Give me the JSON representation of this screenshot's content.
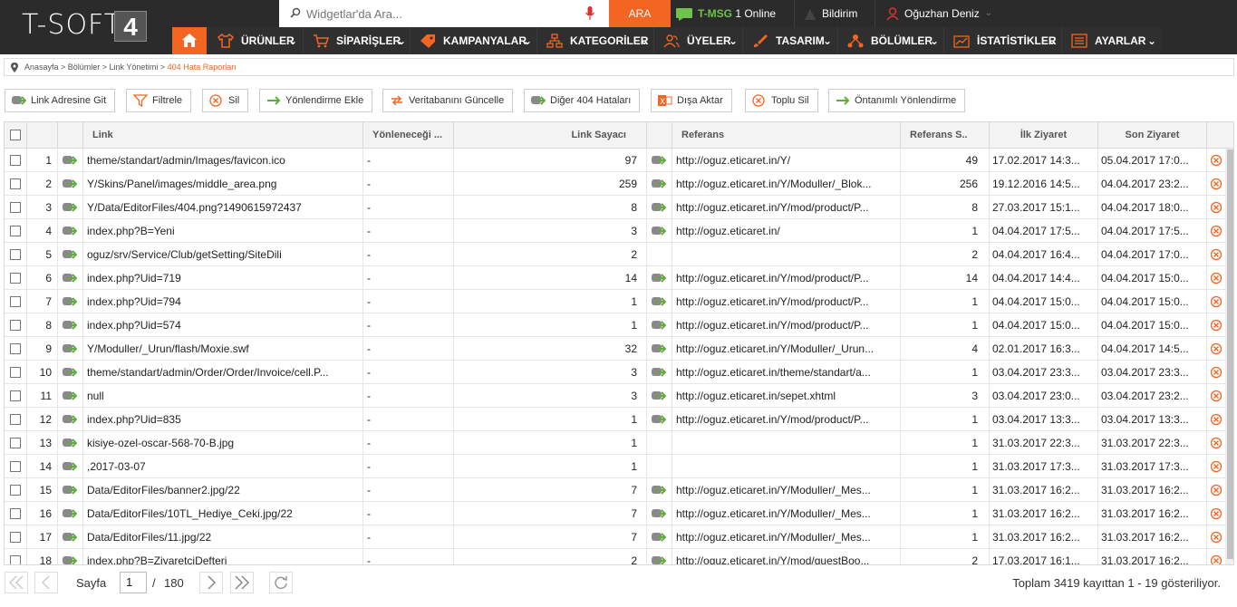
{
  "brand": {
    "logo_text": "T-SOFT",
    "logo_version": "4"
  },
  "search": {
    "placeholder": "Widgetlar'da Ara...",
    "button": "ARA"
  },
  "topbar": {
    "tmsg_label": "T-MSG",
    "tmsg_status": "1 Online",
    "bildirim": "Bildirim",
    "user_name": "Oğuzhan Deniz"
  },
  "nav": [
    {
      "label": "ÜRÜNLER",
      "icon": "shirt-icon"
    },
    {
      "label": "SİPARİŞLER",
      "icon": "cart-icon"
    },
    {
      "label": "KAMPANYALAR",
      "icon": "tag-icon"
    },
    {
      "label": "KATEGORİLER",
      "icon": "sitemap-icon"
    },
    {
      "label": "ÜYELER",
      "icon": "users-icon"
    },
    {
      "label": "TASARIM",
      "icon": "brush-icon"
    },
    {
      "label": "BÖLÜMLER",
      "icon": "network-icon"
    },
    {
      "label": "İSTATİSTİKLER",
      "icon": "chart-icon"
    },
    {
      "label": "AYARLAR",
      "icon": "list-icon"
    }
  ],
  "breadcrumb": {
    "path": "Anasayfa > Bölümler > Link Yönetimi > ",
    "active": "404 Hata Raporları"
  },
  "toolbar": [
    {
      "label": "Link Adresine Git",
      "icon": "go-icon"
    },
    {
      "label": "Filtrele",
      "icon": "filter-icon"
    },
    {
      "label": "Sil",
      "icon": "delete-icon"
    },
    {
      "label": "Yönlendirme Ekle",
      "icon": "arrow-right-icon"
    },
    {
      "label": "Veritabanını Güncelle",
      "icon": "refresh-icon"
    },
    {
      "label": "Diğer 404 Hataları",
      "icon": "go-icon"
    },
    {
      "label": "Dışa Aktar",
      "icon": "excel-icon"
    },
    {
      "label": "Toplu Sil",
      "icon": "delete-icon"
    },
    {
      "label": "Öntanımlı Yönlendirme",
      "icon": "arrow-right-icon"
    }
  ],
  "columns": {
    "link": "Link",
    "redirect": "Yönleneceği ...",
    "link_count": "Link Sayacı",
    "referer": "Referans",
    "referer_count": "Referans S..",
    "first_visit": "İlk Ziyaret",
    "last_visit": "Son Ziyaret"
  },
  "rows": [
    {
      "no": "1",
      "link": "theme/standart/admin/Images/favicon.ico",
      "redirect": "-",
      "count": "97",
      "referer": "http://oguz.eticaret.in/Y/",
      "ref_count": "49",
      "first": "17.02.2017 14:3...",
      "last": "05.04.2017 17:0..."
    },
    {
      "no": "2",
      "link": "Y/Skins/Panel/images/middle_area.png",
      "redirect": "-",
      "count": "259",
      "referer": "http://oguz.eticaret.in/Y/Moduller/_Blok...",
      "ref_count": "256",
      "first": "19.12.2016 14:5...",
      "last": "04.04.2017 23:2..."
    },
    {
      "no": "3",
      "link": "Y/Data/EditorFiles/404.png?1490615972437",
      "redirect": "-",
      "count": "8",
      "referer": "http://oguz.eticaret.in/Y/mod/product/P...",
      "ref_count": "8",
      "first": "27.03.2017 15:1...",
      "last": "04.04.2017 18:0..."
    },
    {
      "no": "4",
      "link": "index.php?B=Yeni",
      "redirect": "-",
      "count": "3",
      "referer": "http://oguz.eticaret.in/",
      "ref_count": "1",
      "first": "04.04.2017 17:5...",
      "last": "04.04.2017 17:5..."
    },
    {
      "no": "5",
      "link": "oguz/srv/Service/Club/getSetting/SiteDili",
      "redirect": "-",
      "count": "2",
      "referer": "",
      "ref_count": "2",
      "first": "04.04.2017 16:4...",
      "last": "04.04.2017 17:0..."
    },
    {
      "no": "6",
      "link": "index.php?Uid=719",
      "redirect": "-",
      "count": "14",
      "referer": "http://oguz.eticaret.in/Y/mod/product/P...",
      "ref_count": "14",
      "first": "04.04.2017 14:4...",
      "last": "04.04.2017 15:0..."
    },
    {
      "no": "7",
      "link": "index.php?Uid=794",
      "redirect": "-",
      "count": "1",
      "referer": "http://oguz.eticaret.in/Y/mod/product/P...",
      "ref_count": "1",
      "first": "04.04.2017 15:0...",
      "last": "04.04.2017 15:0..."
    },
    {
      "no": "8",
      "link": "index.php?Uid=574",
      "redirect": "-",
      "count": "1",
      "referer": "http://oguz.eticaret.in/Y/mod/product/P...",
      "ref_count": "1",
      "first": "04.04.2017 15:0...",
      "last": "04.04.2017 15:0..."
    },
    {
      "no": "9",
      "link": "Y/Moduller/_Urun/flash/Moxie.swf",
      "redirect": "-",
      "count": "32",
      "referer": "http://oguz.eticaret.in/Y/Moduller/_Urun...",
      "ref_count": "4",
      "first": "02.01.2017 16:3...",
      "last": "04.04.2017 14:5..."
    },
    {
      "no": "10",
      "link": "theme/standart/admin/Order/Order/Invoice/cell.P...",
      "redirect": "-",
      "count": "3",
      "referer": "http://oguz.eticaret.in/theme/standart/a...",
      "ref_count": "1",
      "first": "03.04.2017 23:3...",
      "last": "03.04.2017 23:3..."
    },
    {
      "no": "11",
      "link": "null",
      "redirect": "-",
      "count": "3",
      "referer": "http://oguz.eticaret.in/sepet.xhtml",
      "ref_count": "3",
      "first": "03.04.2017 23:0...",
      "last": "03.04.2017 23:2..."
    },
    {
      "no": "12",
      "link": "index.php?Uid=835",
      "redirect": "-",
      "count": "1",
      "referer": "http://oguz.eticaret.in/Y/mod/product/P...",
      "ref_count": "1",
      "first": "03.04.2017 13:3...",
      "last": "03.04.2017 13:3..."
    },
    {
      "no": "13",
      "link": "kisiye-ozel-oscar-568-70-B.jpg",
      "redirect": "-",
      "count": "1",
      "referer": "",
      "ref_count": "1",
      "first": "31.03.2017 22:3...",
      "last": "31.03.2017 22:3..."
    },
    {
      "no": "14",
      "link": ",2017-03-07",
      "redirect": "-",
      "count": "1",
      "referer": "",
      "ref_count": "1",
      "first": "31.03.2017 17:3...",
      "last": "31.03.2017 17:3..."
    },
    {
      "no": "15",
      "link": "Data/EditorFiles/banner2.jpg/22",
      "redirect": "-",
      "count": "7",
      "referer": "http://oguz.eticaret.in/Y/Moduller/_Mes...",
      "ref_count": "1",
      "first": "31.03.2017 16:2...",
      "last": "31.03.2017 16:2..."
    },
    {
      "no": "16",
      "link": "Data/EditorFiles/10TL_Hediye_Ceki.jpg/22",
      "redirect": "-",
      "count": "7",
      "referer": "http://oguz.eticaret.in/Y/Moduller/_Mes...",
      "ref_count": "1",
      "first": "31.03.2017 16:2...",
      "last": "31.03.2017 16:2..."
    },
    {
      "no": "17",
      "link": "Data/EditorFiles/11.jpg/22",
      "redirect": "-",
      "count": "7",
      "referer": "http://oguz.eticaret.in/Y/Moduller/_Mes...",
      "ref_count": "1",
      "first": "31.03.2017 16:2...",
      "last": "31.03.2017 16:2..."
    },
    {
      "no": "18",
      "link": "index.php?B=ZiyaretciDefteri",
      "redirect": "-",
      "count": "2",
      "referer": "http://oguz.eticaret.in/Y/mod/guestBoo...",
      "ref_count": "2",
      "first": "17.03.2017 16:1...",
      "last": "31.03.2017 16:2..."
    }
  ],
  "pager": {
    "label": "Sayfa",
    "current": "1",
    "separator": "/",
    "total_pages": "180",
    "summary": "Toplam 3419 kayıttan 1 - 19 gösteriliyor."
  },
  "colors": {
    "accent": "#f26522",
    "topbar": "#2b2b2b",
    "green": "#6fc24b"
  }
}
